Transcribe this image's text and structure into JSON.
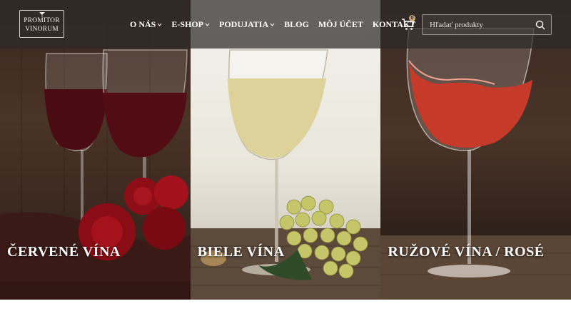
{
  "brand": {
    "logo_line1": "PROMITOR",
    "logo_line2": "VINORUM"
  },
  "nav": {
    "items": [
      {
        "label": "O NÁS",
        "has_dropdown": true
      },
      {
        "label": "E-SHOP",
        "has_dropdown": true
      },
      {
        "label": "PODUJATIA",
        "has_dropdown": true
      },
      {
        "label": "BLOG",
        "has_dropdown": false
      },
      {
        "label": "MÔJ ÚČET",
        "has_dropdown": false
      },
      {
        "label": "KONTAKT",
        "has_dropdown": false
      }
    ]
  },
  "cart": {
    "icon": "cart-icon",
    "count": "0"
  },
  "search": {
    "placeholder": "Hľadať produkty",
    "icon": "search-icon"
  },
  "categories": [
    {
      "label": "ČERVENÉ VÍNA"
    },
    {
      "label": "BIELE VÍNA"
    },
    {
      "label": "RUŽOVÉ VÍNA / ROSÉ"
    }
  ],
  "colors": {
    "header_overlay": "#2d2a28",
    "text": "#ffffff",
    "accent": "#c9a96e"
  }
}
